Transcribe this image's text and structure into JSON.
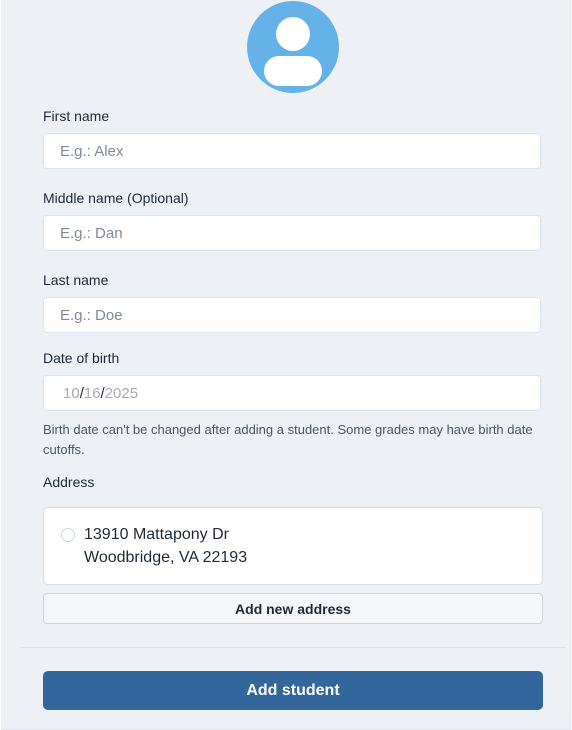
{
  "colors": {
    "avatar": "#64b2e8",
    "primary_button": "#33669a",
    "panel_background": "#edf1f6"
  },
  "avatar": {
    "icon": "user-avatar-icon"
  },
  "form": {
    "first_name": {
      "label": "First name",
      "placeholder": "E.g.: Alex",
      "value": ""
    },
    "middle_name": {
      "label": "Middle name (Optional)",
      "placeholder": "E.g.: Dan",
      "value": ""
    },
    "last_name": {
      "label": "Last name",
      "placeholder": "E.g.: Doe",
      "value": ""
    },
    "date_of_birth": {
      "label": "Date of birth",
      "month": "10",
      "day": "16",
      "year": "2025",
      "separator": "/",
      "helper": "Birth date can't be changed after adding a student. Some grades may have birth date cutoffs."
    },
    "address": {
      "label": "Address",
      "options": [
        {
          "line1": "13910 Mattapony Dr",
          "line2": "Woodbridge, VA 22193",
          "selected": false
        }
      ],
      "add_button_label": "Add new address"
    },
    "submit_label": "Add student"
  }
}
